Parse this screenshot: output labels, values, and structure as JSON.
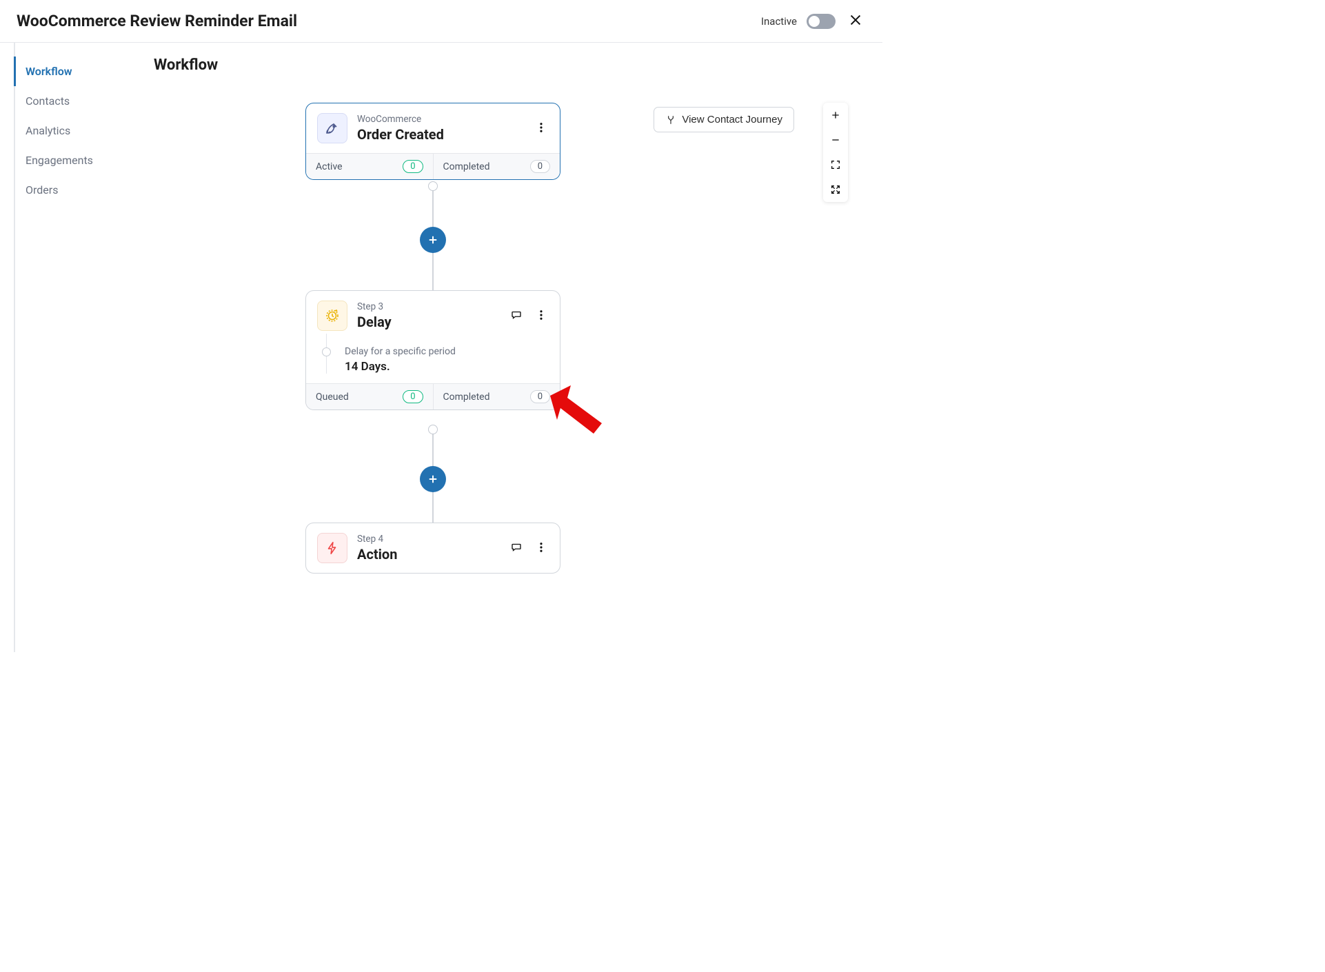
{
  "header": {
    "title": "WooCommerce Review Reminder Email",
    "status_label": "Inactive"
  },
  "sidebar": {
    "items": [
      {
        "label": "Workflow",
        "active": true
      },
      {
        "label": "Contacts"
      },
      {
        "label": "Analytics"
      },
      {
        "label": "Engagements"
      },
      {
        "label": "Orders"
      }
    ]
  },
  "page": {
    "title": "Workflow",
    "journey_button": "View Contact Journey"
  },
  "nodes": {
    "trigger": {
      "subtitle": "WooCommerce",
      "title": "Order Created",
      "stat1_label": "Active",
      "stat1_value": "0",
      "stat2_label": "Completed",
      "stat2_value": "0"
    },
    "delay": {
      "subtitle": "Step 3",
      "title": "Delay",
      "body_label": "Delay for a specific period",
      "body_value": "14 Days.",
      "stat1_label": "Queued",
      "stat1_value": "0",
      "stat2_label": "Completed",
      "stat2_value": "0"
    },
    "action": {
      "subtitle": "Step 4",
      "title": "Action"
    }
  }
}
